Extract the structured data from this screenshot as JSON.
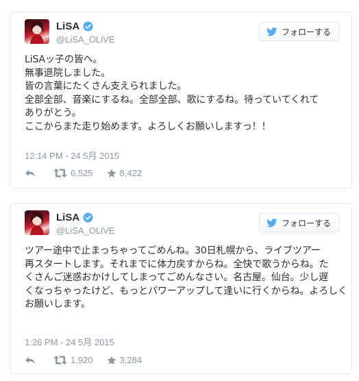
{
  "tweets": [
    {
      "display_name": "LiSA",
      "handle": "@LiSA_OLiVE",
      "follow_label": "フォローする",
      "lines": [
        "LiSAッ子の皆へ。",
        "無事退院しました。",
        "皆の言葉にたくさん支えられました。",
        "全部全部、音楽にするね。全部全部、歌にするね。待っていてくれて",
        "ありがとう。",
        "ここからまた走り始めます。よろしくお願いしますっ！！"
      ],
      "timestamp": "12:14 PM - 24 5月 2015",
      "retweets": "6,525",
      "favorites": "8,422"
    },
    {
      "display_name": "LiSA",
      "handle": "@LiSA_OLiVE",
      "follow_label": "フォローする",
      "lines": [
        "ツアー途中で止まっちゃってごめんね。30日札幌から、ライブツアー",
        "再スタートします。それまでに体力戻すからね。全快で歌うからね。た",
        "くさんご迷惑おかけしてしまってごめんなさい。名古屋。仙台。少し遅",
        "くなっちゃったけど、もっとパワーアップして逢いに行くからね。よろしく",
        "お願いします。"
      ],
      "timestamp": "1:26 PM - 24 5月 2015",
      "retweets": "1,920",
      "favorites": "3,284"
    }
  ],
  "colors": {
    "twitter_blue": "#55acee",
    "muted": "#8899a6",
    "text": "#292f33",
    "border": "#e1e8ed"
  },
  "icons": [
    "verified-badge-icon",
    "twitter-bird-icon",
    "reply-icon",
    "retweet-icon",
    "favorite-star-icon"
  ]
}
